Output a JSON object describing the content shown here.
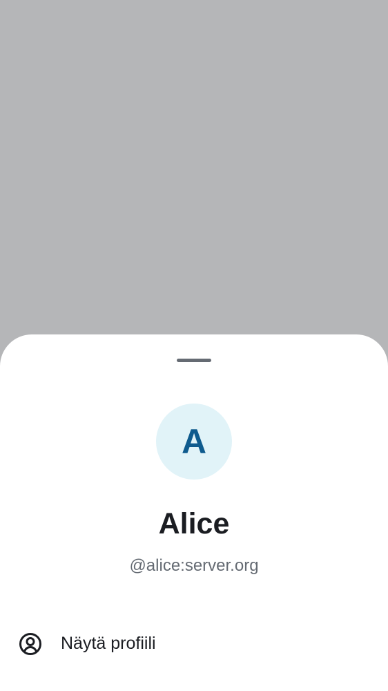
{
  "sheet": {
    "avatar_letter": "A",
    "display_name": "Alice",
    "user_id": "@alice:server.org",
    "actions": [
      {
        "label": "Näytä profiili",
        "icon": "user-profile-icon"
      }
    ]
  },
  "colors": {
    "scrim": "#b5b6b8",
    "sheet_background": "#ffffff",
    "avatar_background": "#e1f3f8",
    "avatar_letter": "#0f5b8e",
    "primary_text": "#1b1d22",
    "secondary_text": "#656b73"
  }
}
